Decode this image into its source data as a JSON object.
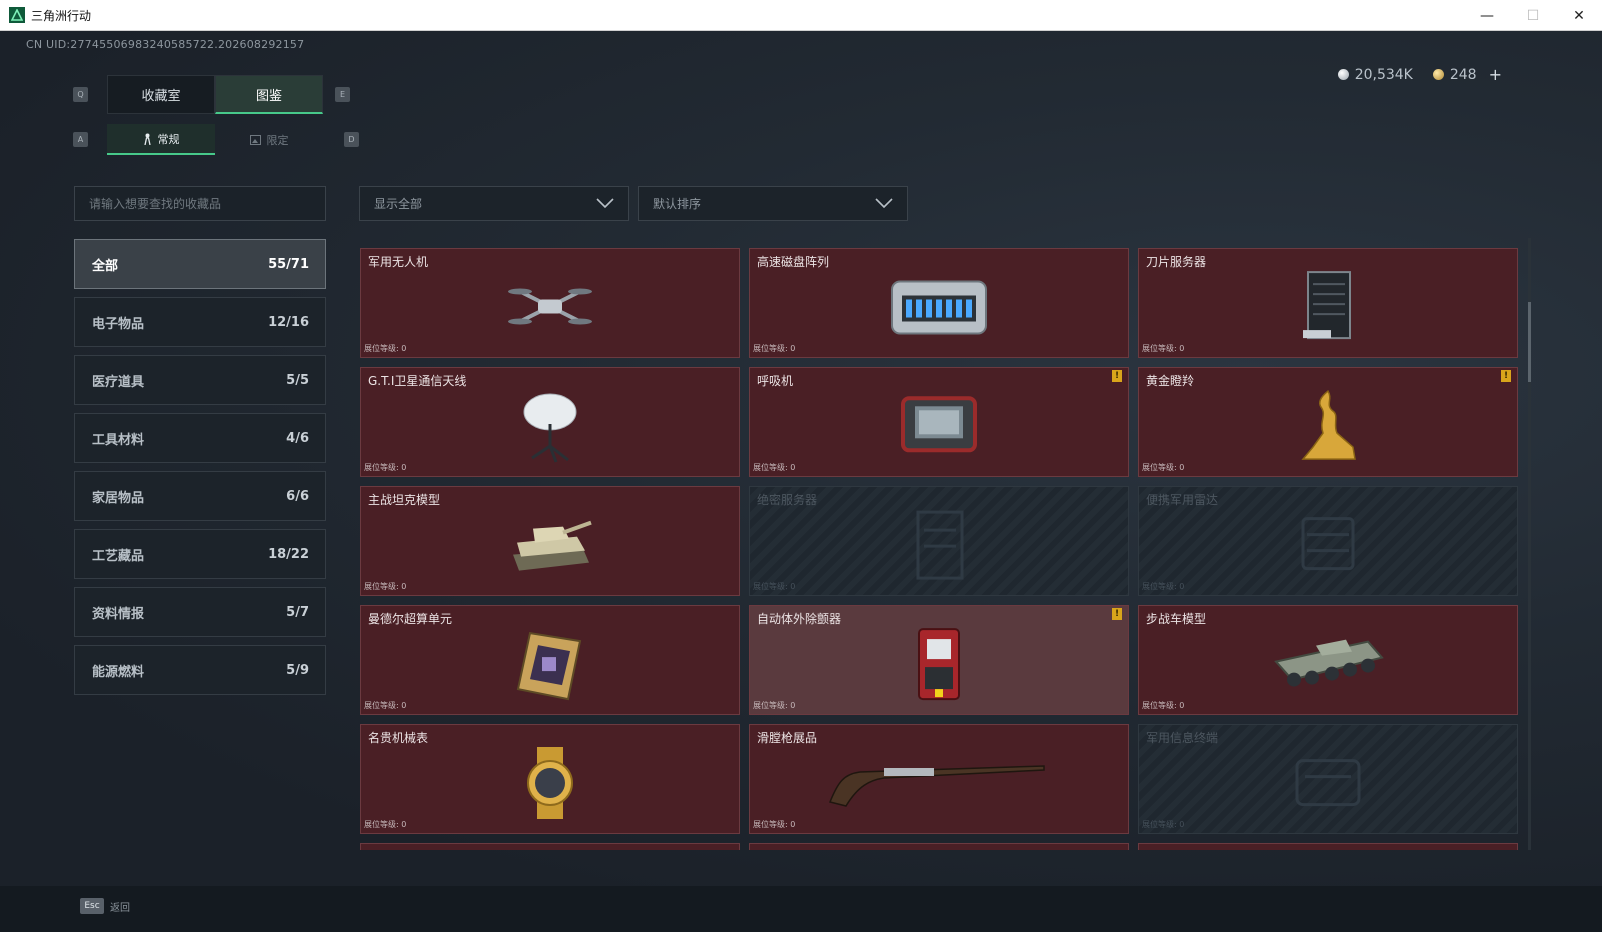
{
  "window": {
    "title": "三角洲行动",
    "minimize": "—",
    "maximize": "☐",
    "close": "✕"
  },
  "uid": "CN UID:27745506983240585722.202608292157",
  "currency": {
    "silver": "20,534K",
    "gold": "248",
    "plus": "+"
  },
  "keys": {
    "prev_tab": "Q",
    "next_tab": "E",
    "prev_sub": "A",
    "next_sub": "D"
  },
  "tabs": [
    {
      "label": "收藏室"
    },
    {
      "label": "图鉴"
    }
  ],
  "subtabs": [
    {
      "label": "常规"
    },
    {
      "label": "限定"
    }
  ],
  "search": {
    "placeholder": "请输入想要查找的收藏品"
  },
  "filters": {
    "display": "显示全部",
    "sort": "默认排序"
  },
  "categories": [
    {
      "label": "全部",
      "count": "55/71"
    },
    {
      "label": "电子物品",
      "count": "12/16"
    },
    {
      "label": "医疗道具",
      "count": "5/5"
    },
    {
      "label": "工具材料",
      "count": "4/6"
    },
    {
      "label": "家居物品",
      "count": "6/6"
    },
    {
      "label": "工艺藏品",
      "count": "18/22"
    },
    {
      "label": "资料情报",
      "count": "5/7"
    },
    {
      "label": "能源燃料",
      "count": "5/9"
    }
  ],
  "items": [
    {
      "name": "军用无人机",
      "level": "展位等级: 0",
      "icon": "drone-icon"
    },
    {
      "name": "高速磁盘阵列",
      "level": "展位等级: 0",
      "icon": "disk-array-icon"
    },
    {
      "name": "刀片服务器",
      "level": "展位等级: 0",
      "icon": "blade-server-icon"
    },
    {
      "name": "G.T.I卫星通信天线",
      "level": "展位等级: 0",
      "icon": "satellite-antenna-icon"
    },
    {
      "name": "呼吸机",
      "level": "展位等级: 0",
      "icon": "ventilator-icon",
      "warn": "!"
    },
    {
      "name": "黄金瞪羚",
      "level": "展位等级: 0",
      "icon": "golden-gazelle-icon",
      "warn": "!"
    },
    {
      "name": "主战坦克模型",
      "level": "展位等级: 0",
      "icon": "tank-model-icon"
    },
    {
      "name": "绝密服务器",
      "level": "展位等级: 0",
      "icon": "secret-server-icon"
    },
    {
      "name": "便携军用雷达",
      "level": "展位等级: 0",
      "icon": "portable-radar-icon"
    },
    {
      "name": "曼德尔超算单元",
      "level": "展位等级: 0",
      "icon": "supercomputer-unit-icon"
    },
    {
      "name": "自动体外除颤器",
      "level": "展位等级: 0",
      "icon": "defibrillator-icon",
      "warn": "!"
    },
    {
      "name": "步战车模型",
      "level": "展位等级: 0",
      "icon": "ifv-model-icon"
    },
    {
      "name": "名贵机械表",
      "level": "展位等级: 0",
      "icon": "watch-icon"
    },
    {
      "name": "滑膛枪展品",
      "level": "展位等级: 0",
      "icon": "musket-icon"
    },
    {
      "name": "军用信息终端",
      "level": "展位等级: 0",
      "icon": "military-terminal-icon"
    }
  ],
  "footer": {
    "esc_key": "Esc",
    "esc_label": "返回"
  },
  "colors": {
    "accent": "#47c98a",
    "card_owned": "#4a1f25",
    "card_locked": "#1f272f",
    "warn": "#d9a51b"
  }
}
